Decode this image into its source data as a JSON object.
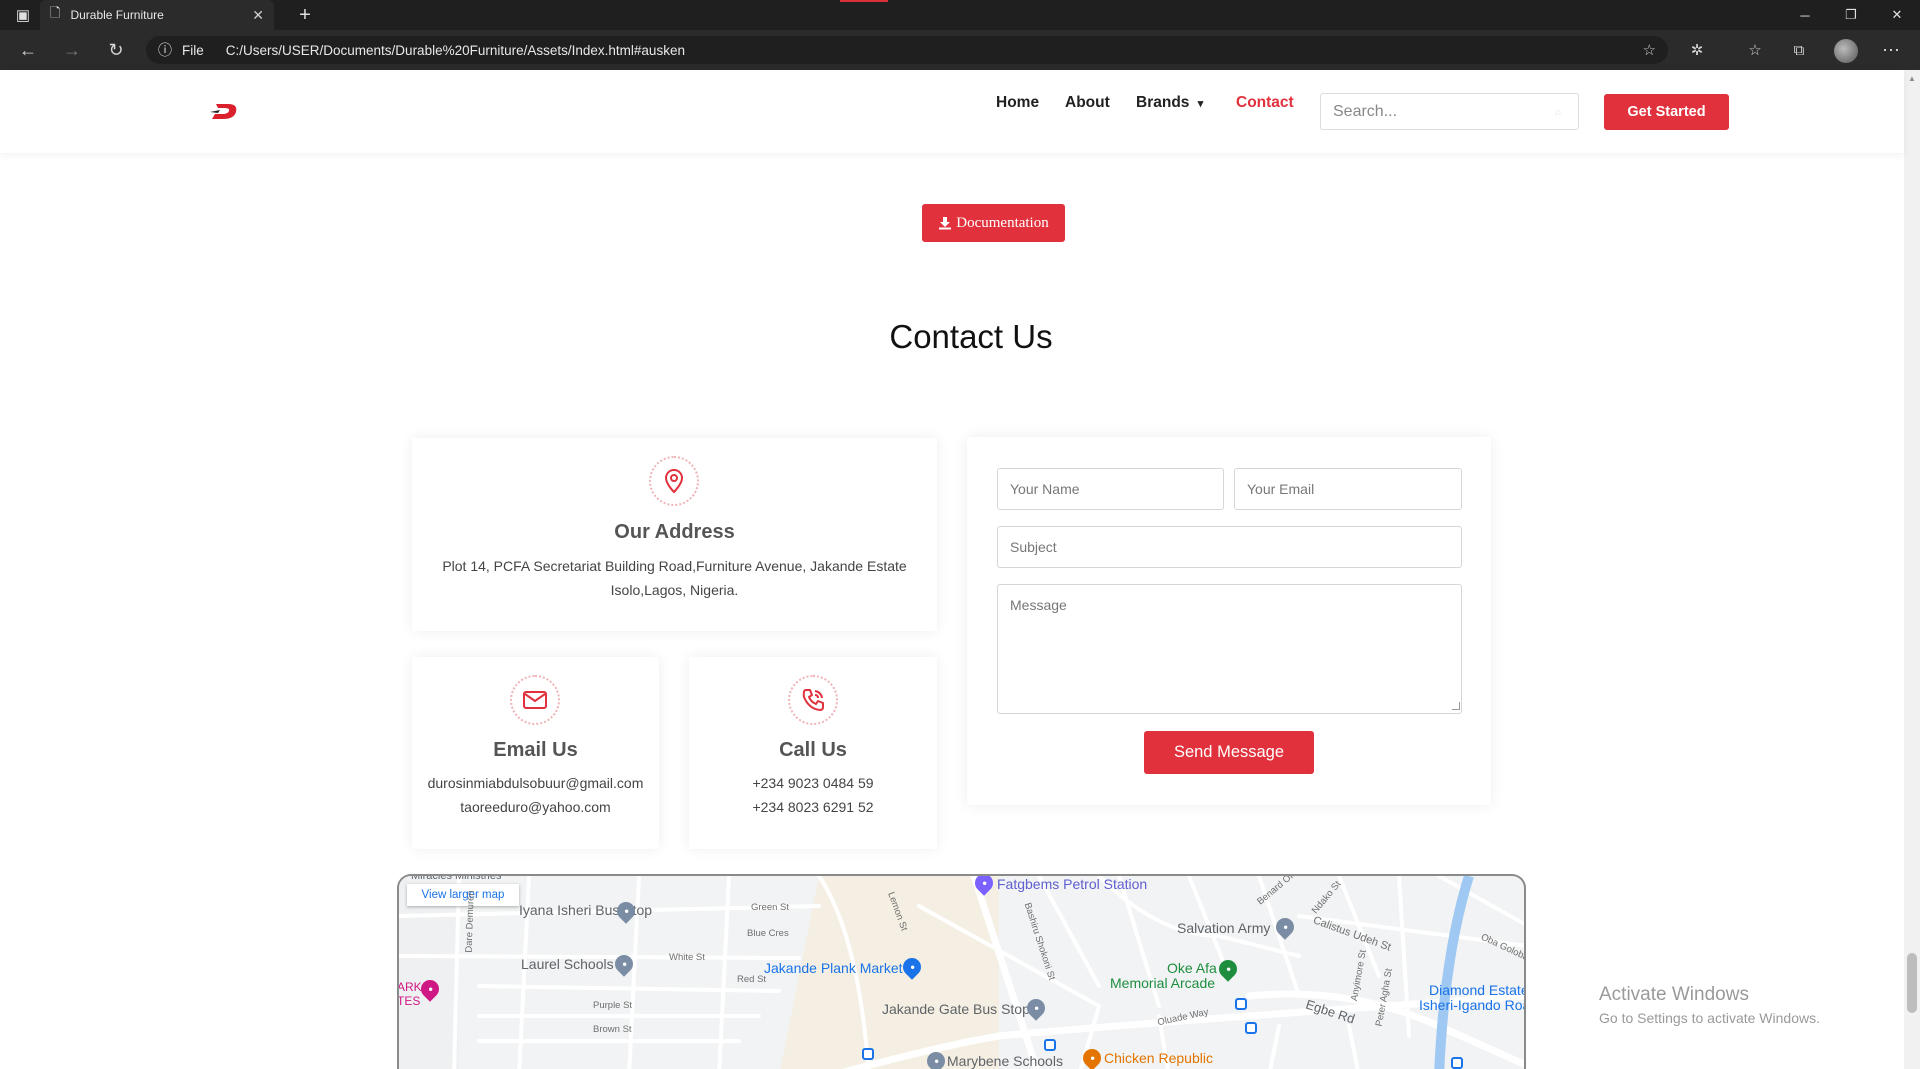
{
  "browser": {
    "tab_title": "Durable Furniture",
    "url_scheme_label": "File",
    "url": "C:/Users/USER/Documents/Durable%20Furniture/Assets/Index.html#ausken"
  },
  "header": {
    "nav": [
      "Home",
      "About",
      "Brands",
      "Contact"
    ],
    "active_nav": "Contact",
    "search_placeholder": "Search...",
    "cta_label": "Get Started"
  },
  "documentation_label": "Documentation",
  "contact": {
    "title": "Contact Us",
    "address": {
      "title": "Our Address",
      "line1": "Plot 14, PCFA Secretariat Building Road,Furniture Avenue, Jakande Estate",
      "line2": "Isolo,Lagos, Nigeria."
    },
    "email": {
      "title": "Email Us",
      "line1": "durosinmiabdulsobuur@gmail.com",
      "line2": "taoreeduro@yahoo.com"
    },
    "call": {
      "title": "Call Us",
      "line1": "+234 9023 0484 59",
      "line2": "+234 8023 6291 52"
    },
    "form": {
      "name_placeholder": "Your Name",
      "email_placeholder": "Your Email",
      "subject_placeholder": "Subject",
      "message_placeholder": "Message",
      "submit_label": "Send Message"
    }
  },
  "map": {
    "view_larger": "View larger map",
    "places": {
      "miracles": "Miracles Ministries",
      "iyana": "Iyana Isheri Bus Stop",
      "laurel": "Laurel Schools",
      "fatgbems": "Fatgbems Petrol Station",
      "plank": "Jakande Plank Market",
      "gate": "Jakande Gate Bus Stop",
      "marybene": "Marybene Schools",
      "chicken": "Chicken Republic",
      "salvation": "Salvation Army",
      "okeafa1": "Oke Afa",
      "okeafa2": "Memorial Arcade",
      "diamond1": "Diamond Estate",
      "diamond2": "Isheri-Igando Road",
      "park1": "ARK",
      "park2": "TES"
    },
    "streets": {
      "green": "Green St",
      "blue": "Blue Cres",
      "white": "White St",
      "red": "Red St",
      "purple": "Purple St",
      "brown": "Brown St",
      "lemon": "Lemon St",
      "bashiru": "Bashiru Shokoni St",
      "benard": "Benard Ofo",
      "ndako": "Ndako St",
      "calistus": "Calistus Udeh St",
      "oba": "Oba Goloba",
      "egbe": "Egbe Rd",
      "oluade": "Oluade Way",
      "peter": "Peter Agha St",
      "anyim": "Anyimore St",
      "dare": "Dare Demuren"
    }
  },
  "windows_watermark": {
    "title": "Activate Windows",
    "subtitle": "Go to Settings to activate Windows."
  }
}
